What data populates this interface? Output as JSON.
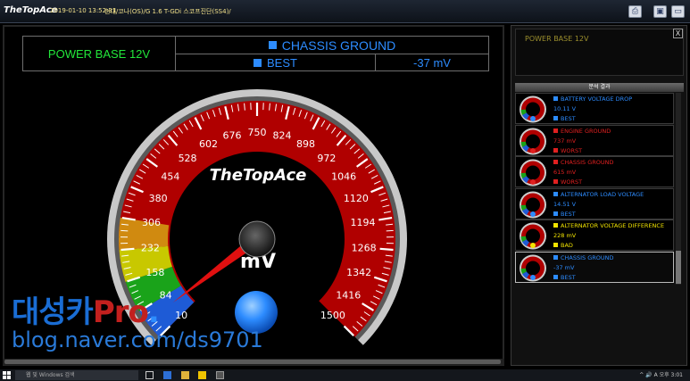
{
  "window": {
    "app_title": "TheTopAce",
    "datetime": "2019-01-10 13:52:31",
    "vehicle_info": "현대/코나(OS)/G 1.6 T-GDi 스코프진단(SS4)/"
  },
  "header": {
    "power_base": "POWER BASE 12V",
    "channel": "CHASSIS GROUND",
    "status": "BEST",
    "reading": "-37 mV",
    "channel_color": "#2d8cff",
    "power_color": "#22e63a"
  },
  "gauge": {
    "brand": "TheTopAce",
    "unit": "mV",
    "ticks": [
      "10",
      "84",
      "158",
      "232",
      "306",
      "380",
      "454",
      "528",
      "602",
      "676",
      "750",
      "824",
      "898",
      "972",
      "1046",
      "1120",
      "1194",
      "1268",
      "1342",
      "1416",
      "1500"
    ],
    "needle_value": -37,
    "indicator_color": "#2d8cff"
  },
  "watermark": {
    "brand_main": "대성카",
    "brand_pro": "Pro",
    "brand_dot": ".",
    "url": "blog.naver.com/ds9701"
  },
  "side_panel": {
    "top_label": "POWER BASE 12V",
    "close_label": "X",
    "results_title": "분석 결과",
    "results": [
      {
        "name": "BATTERY VOLTAGE DROP",
        "value": "10.11 V",
        "status": "BEST",
        "color": "#2d8cff"
      },
      {
        "name": "ENGINE GROUND",
        "value": "737 mV",
        "status": "WORST",
        "color": "#e02020"
      },
      {
        "name": "CHASSIS GROUND",
        "value": "615 mV",
        "status": "WORST",
        "color": "#e02020"
      },
      {
        "name": "ALTERNATOR LOAD VOLTAGE",
        "value": "14.51 V",
        "status": "BEST",
        "color": "#2d8cff"
      },
      {
        "name": "ALTERNATOR VOLTAGE DIFFERENCE",
        "value": "228 mV",
        "status": "BAD",
        "color": "#f2e400"
      },
      {
        "name": "CHASSIS GROUND",
        "value": "-37 mV",
        "status": "BEST",
        "color": "#2d8cff"
      }
    ]
  },
  "taskbar": {
    "search_placeholder": "웹 및 Windows 검색",
    "tray_text": "^ 🔊 A  오후 3:01"
  }
}
